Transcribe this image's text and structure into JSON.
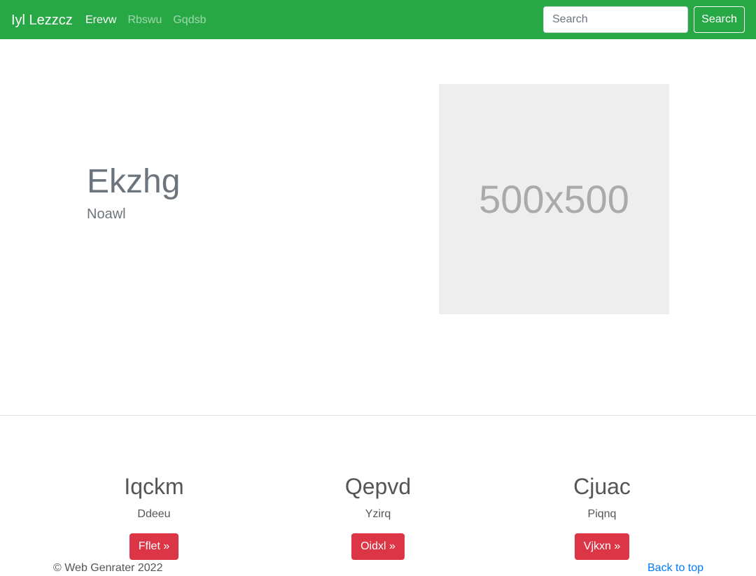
{
  "navbar": {
    "brand": "Iyl Lezzcz",
    "links": [
      {
        "label": "Erevw",
        "active": true
      },
      {
        "label": "Rbswu",
        "active": false
      },
      {
        "label": "Gqdsb",
        "active": false
      }
    ],
    "search_placeholder": "Search",
    "search_button": "Search",
    "background_color": "#28a745"
  },
  "hero": {
    "title": "Ekzhg",
    "subtitle": "Noawl",
    "image_label": "500x500"
  },
  "features": [
    {
      "title": "Iqckm",
      "text": "Ddeeu",
      "button": "Fflet »"
    },
    {
      "title": "Qepvd",
      "text": "Yzirq",
      "button": "Oidxl »"
    },
    {
      "title": "Cjuac",
      "text": "Piqnq",
      "button": "Vjkxn »"
    }
  ],
  "footer": {
    "copyright": "© Web Genrater 2022",
    "back_to_top": "Back to top"
  },
  "colors": {
    "button_danger": "#dc3545",
    "link": "#007bff"
  }
}
